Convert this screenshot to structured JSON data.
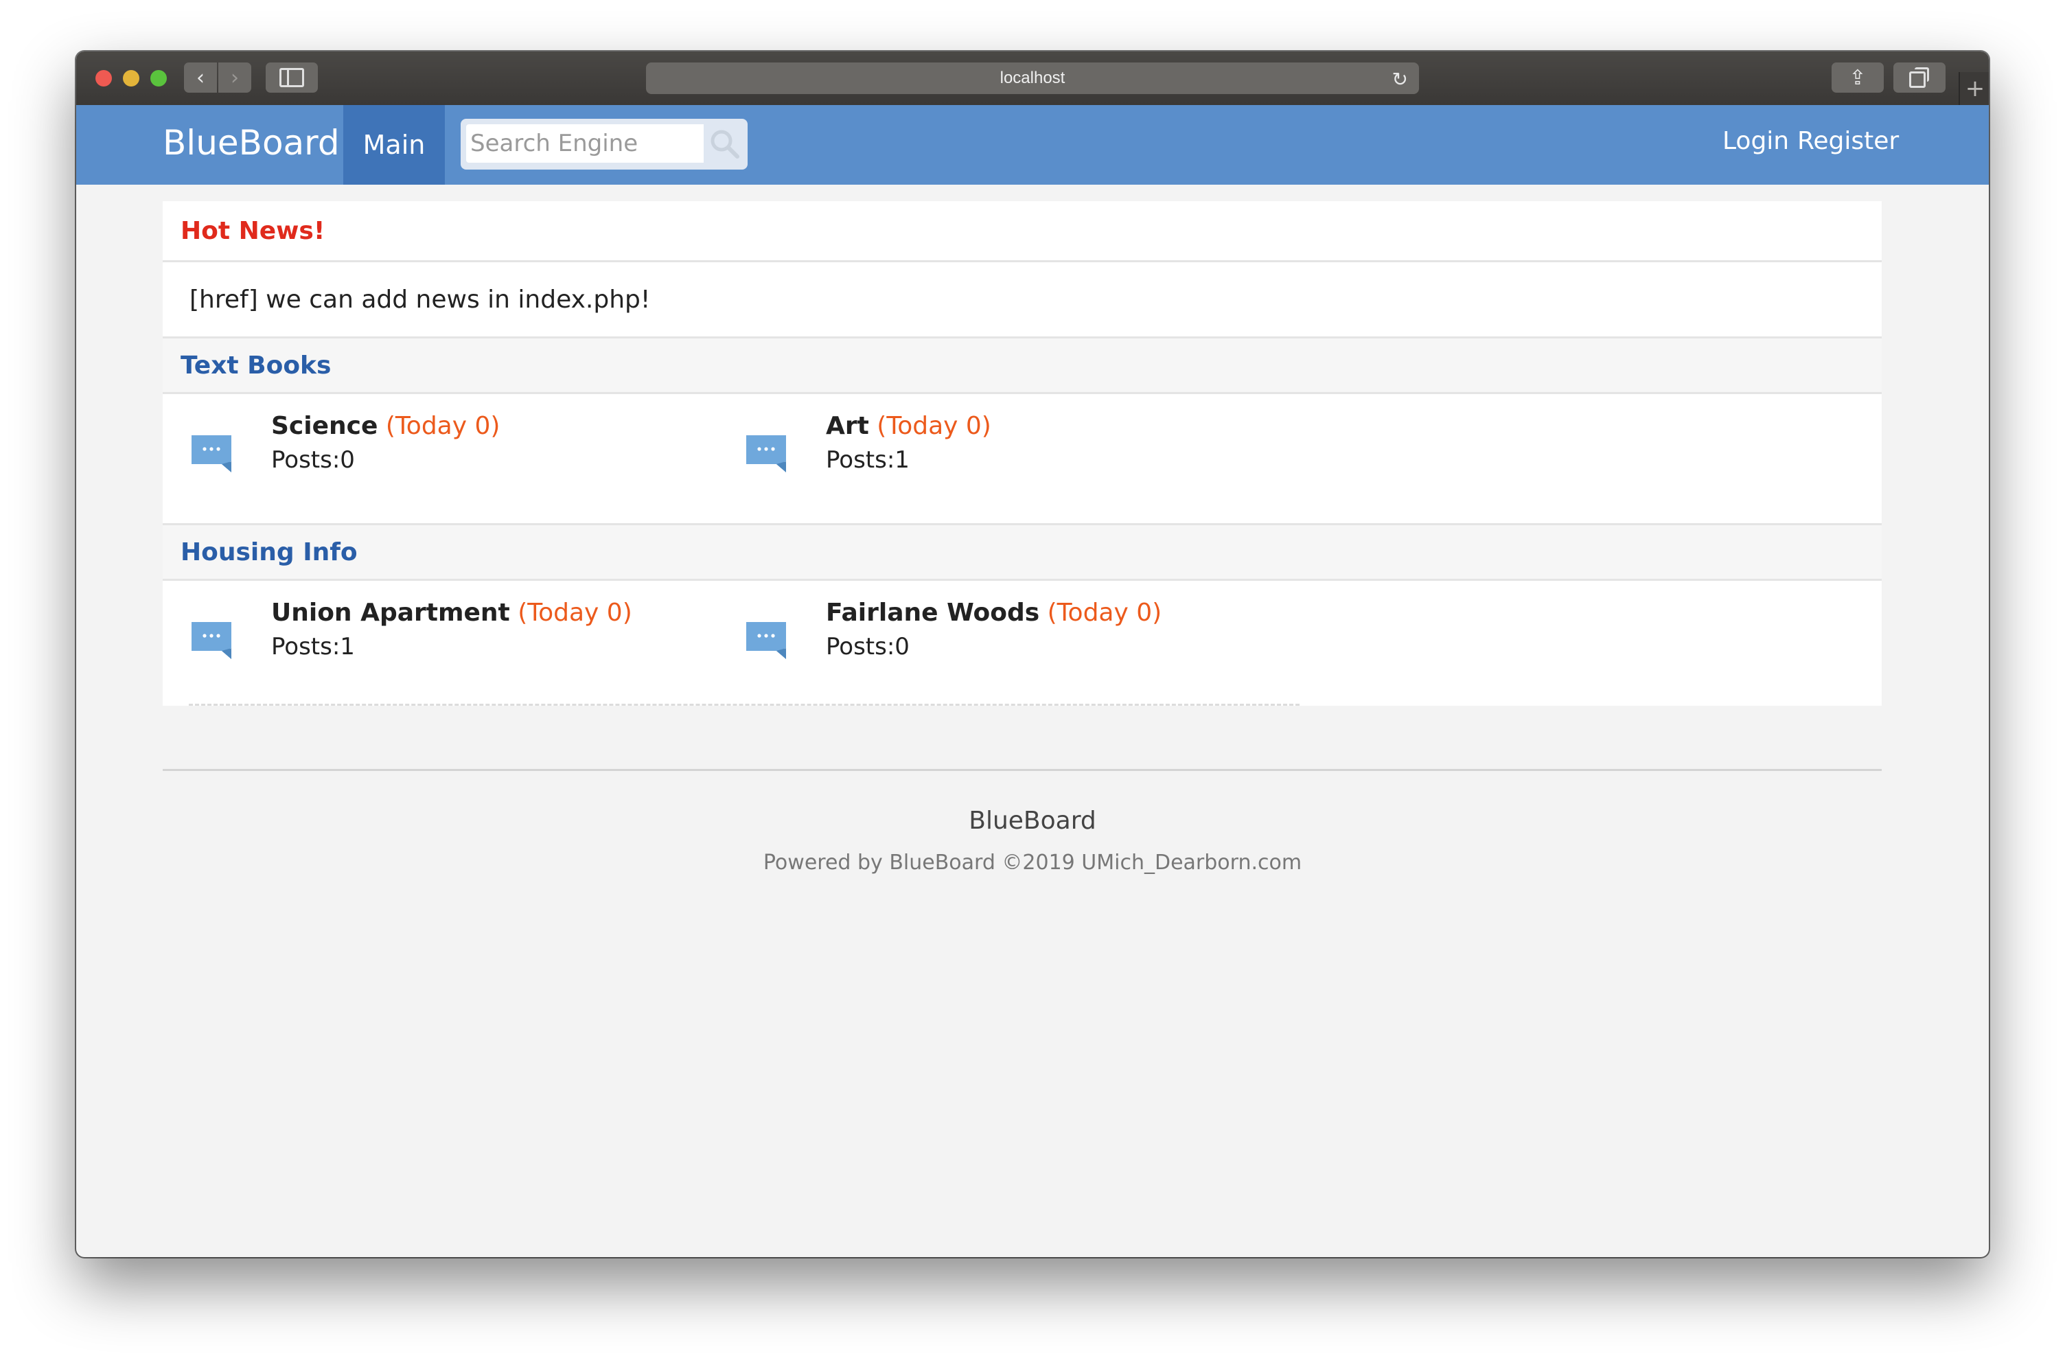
{
  "browser": {
    "url": "localhost",
    "back_glyph": "‹",
    "forward_glyph": "›",
    "reload_glyph": "↻",
    "share_glyph": "⇪",
    "newtab_glyph": "+"
  },
  "navbar": {
    "brand": "BlueBoard",
    "main_tab": "Main",
    "search_placeholder": "Search Engine",
    "login": "Login",
    "register": "Register",
    "bg_color": "#5a8ecb",
    "active_color": "#3f74b8"
  },
  "hot_news": {
    "heading": "Hot News!",
    "body": "[href] we can add news in index.php!",
    "color": "#e02a1c"
  },
  "categories": [
    {
      "name": "Text Books",
      "forums": [
        {
          "title": "Science",
          "today": "(Today 0)",
          "posts": "Posts:0"
        },
        {
          "title": "Art",
          "today": "(Today 0)",
          "posts": "Posts:1"
        }
      ]
    },
    {
      "name": "Housing Info",
      "forums": [
        {
          "title": "Union Apartment",
          "today": "(Today 0)",
          "posts": "Posts:1"
        },
        {
          "title": "Fairlane Woods",
          "today": "(Today 0)",
          "posts": "Posts:0"
        }
      ]
    }
  ],
  "footer": {
    "title": "BlueBoard",
    "powered": "Powered by BlueBoard ©2019 UMich_Dearborn.com"
  },
  "icons": {
    "forum_icon": "chat-bubble-icon",
    "search_icon": "search-icon",
    "chat_color": "#6fa8dc"
  }
}
